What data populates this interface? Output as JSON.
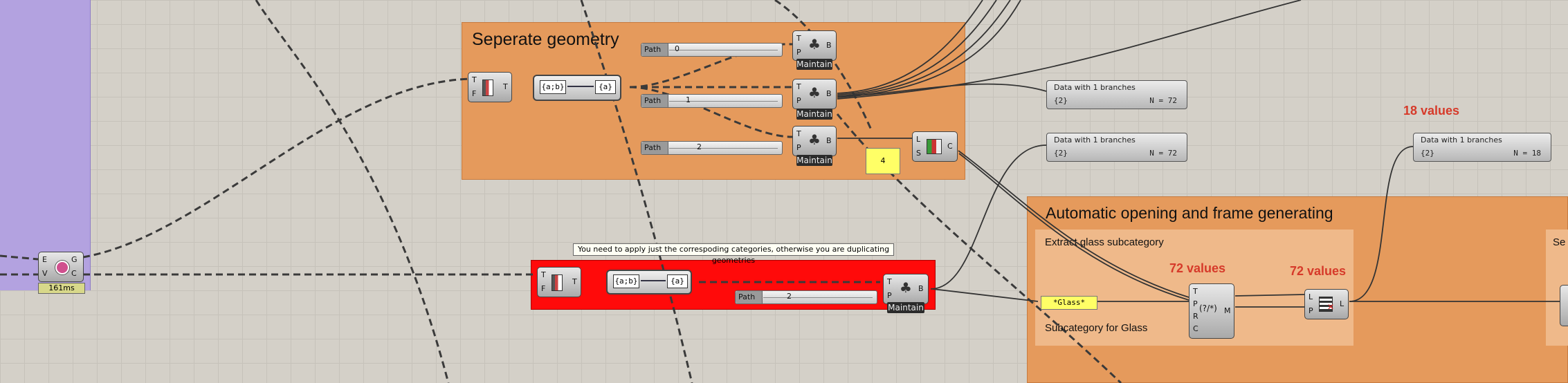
{
  "groups": {
    "separate": {
      "title": "Seperate geometry"
    },
    "automatic": {
      "title": "Automatic opening and frame generating",
      "truncated_title": "Se"
    },
    "extract": {
      "title": "Extract glass subcategory",
      "subtitle": "Subcategory for Glass"
    }
  },
  "tooltip": "You need to apply just the correspoding categories, otherwise you are duplicating geometries",
  "timer": "161ms",
  "paths": [
    {
      "label": "Path",
      "value": "0"
    },
    {
      "label": "Path",
      "value": "1"
    },
    {
      "label": "Path",
      "value": "2"
    },
    {
      "label": "Path",
      "value": "2"
    }
  ],
  "tree_branch": {
    "ports_in": [
      "T",
      "P"
    ],
    "port_out": "B",
    "badge": "Maintain"
  },
  "tree_split": {
    "ports_in": [
      "T",
      "F"
    ],
    "port_out": "T"
  },
  "expression": {
    "left": "{a;b}",
    "right": "{a}"
  },
  "entwine": {
    "ports_in": [
      "L",
      "S"
    ],
    "port_out": "C",
    "value": "4"
  },
  "geom_src": {
    "ports_in": [
      "E",
      "V"
    ],
    "ports_out": [
      "G",
      "C"
    ]
  },
  "panels": [
    {
      "title": "Data with 1 branches",
      "path": "{2}",
      "count": "N = 72"
    },
    {
      "title": "Data with 1 branches",
      "path": "{2}",
      "count": "N = 72"
    },
    {
      "title": "Data with 1 branches",
      "path": "{2}",
      "count": "N = 18"
    }
  ],
  "labels": {
    "count18": "18 values",
    "count72a": "72 values",
    "count72b": "72 values"
  },
  "glass_filter": "*Glass*",
  "match": {
    "ports_in": [
      "T",
      "P",
      "R",
      "C"
    ],
    "port_out": "M",
    "glyph": "(?/*)"
  },
  "cull": {
    "ports_in": [
      "L",
      "P"
    ],
    "port_out": "L"
  },
  "colors": {
    "orange": "#e59a5c",
    "red_group": "#ff0a0a",
    "purple": "#b3a2e0",
    "count_red": "#d63a2a"
  }
}
